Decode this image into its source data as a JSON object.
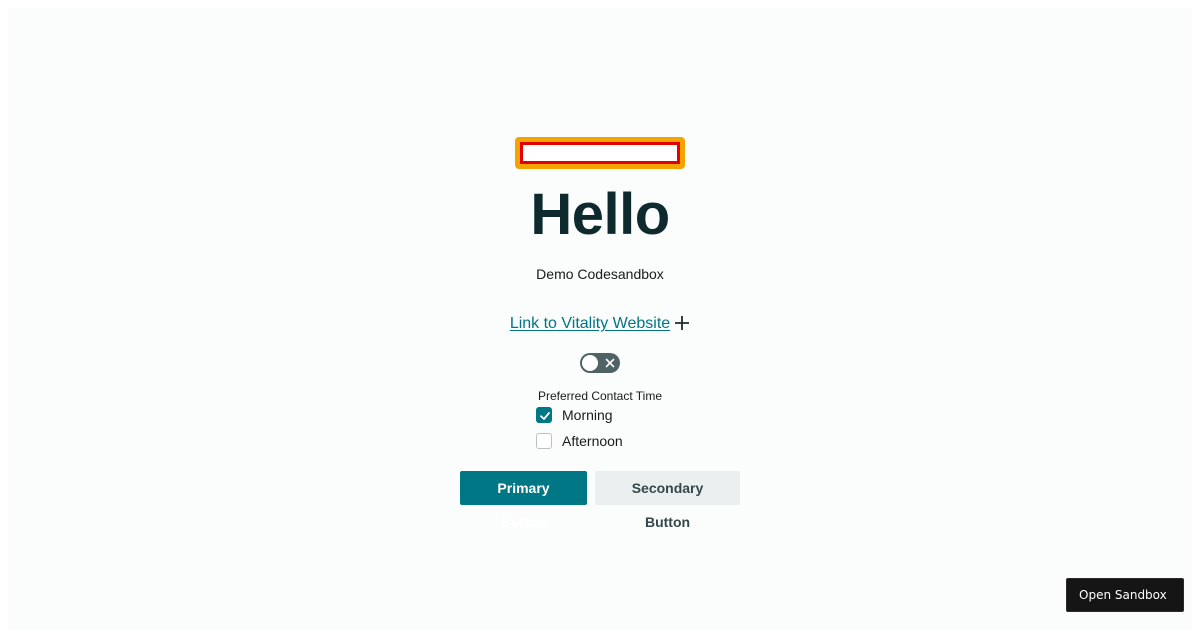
{
  "main": {
    "heading": "Hello",
    "subtitle": "Demo Codesandbox",
    "link_label": "Link to Vitality Website",
    "toggle": {
      "checked": false
    },
    "contact": {
      "legend": "Preferred Contact Time",
      "options": [
        {
          "label": "Morning",
          "checked": true
        },
        {
          "label": "Afternoon",
          "checked": false
        }
      ]
    },
    "buttons": {
      "primary_label": "Primary Button",
      "secondary_label": "Secondary Button"
    }
  },
  "sandbox": {
    "open_label": "Open Sandbox"
  },
  "colors": {
    "accent": "#007784",
    "heading": "#0e2a2e",
    "logo_outer": "#f5a300",
    "logo_inner": "#e50000"
  },
  "icons": [
    "plus-icon",
    "close-icon",
    "checkmark-icon"
  ]
}
